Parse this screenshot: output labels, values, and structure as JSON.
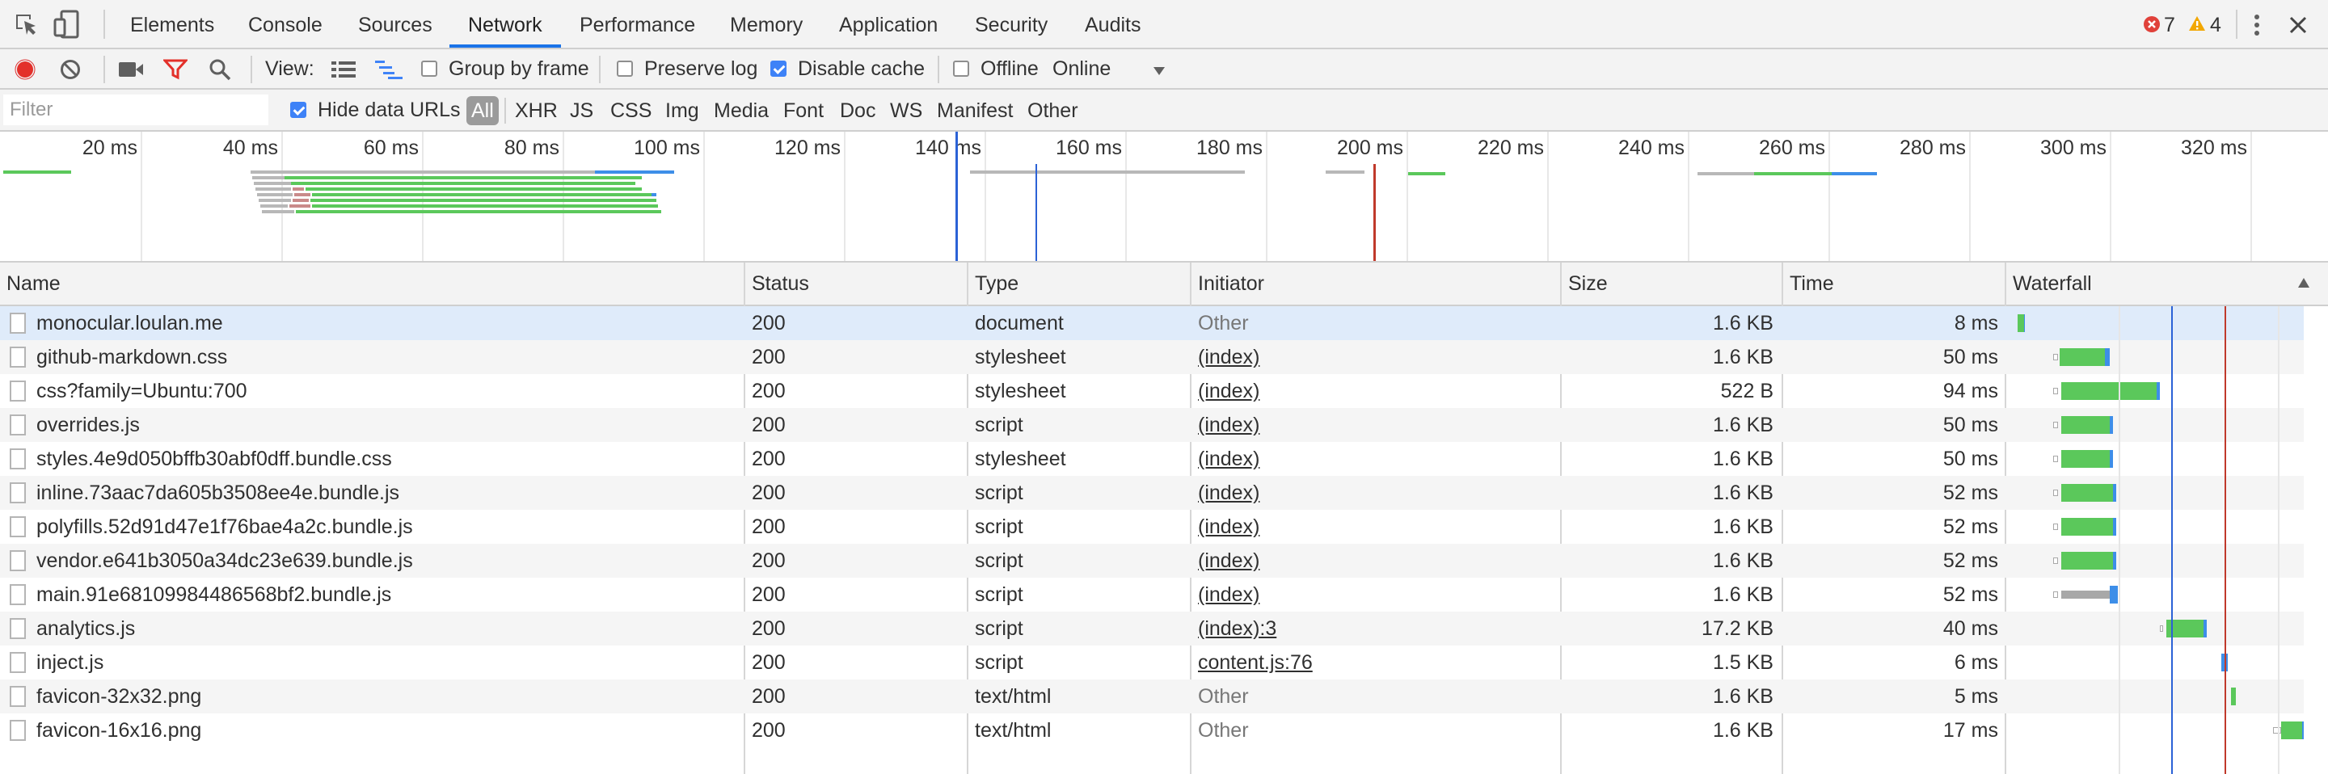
{
  "tabs": [
    "Elements",
    "Console",
    "Sources",
    "Network",
    "Performance",
    "Memory",
    "Application",
    "Security",
    "Audits"
  ],
  "active_tab": "Network",
  "error_count": "7",
  "warning_count": "4",
  "toolbar": {
    "view_label": "View:",
    "group_by_frame": "Group by frame",
    "preserve_log": "Preserve log",
    "disable_cache": "Disable cache",
    "offline": "Offline",
    "throttling": "Online"
  },
  "filter": {
    "placeholder": "Filter",
    "hide_data_urls": "Hide data URLs",
    "types": [
      "All",
      "XHR",
      "JS",
      "CSS",
      "Img",
      "Media",
      "Font",
      "Doc",
      "WS",
      "Manifest",
      "Other"
    ]
  },
  "overview_ticks": [
    "20 ms",
    "40 ms",
    "60 ms",
    "80 ms",
    "100 ms",
    "120 ms",
    "140 ms",
    "160 ms",
    "180 ms",
    "200 ms",
    "220 ms",
    "240 ms",
    "260 ms",
    "280 ms",
    "300 ms",
    "320 ms"
  ],
  "columns": [
    "Name",
    "Status",
    "Type",
    "Initiator",
    "Size",
    "Time",
    "Waterfall"
  ],
  "requests": [
    {
      "name": "monocular.loulan.me",
      "status": "200",
      "type": "document",
      "initiator": "Other",
      "size": "1.6 KB",
      "time": "8 ms"
    },
    {
      "name": "github-markdown.css",
      "status": "200",
      "type": "stylesheet",
      "initiator": "(index)",
      "size": "1.6 KB",
      "time": "50 ms"
    },
    {
      "name": "css?family=Ubuntu:700",
      "status": "200",
      "type": "stylesheet",
      "initiator": "(index)",
      "size": "522 B",
      "time": "94 ms"
    },
    {
      "name": "overrides.js",
      "status": "200",
      "type": "script",
      "initiator": "(index)",
      "size": "1.6 KB",
      "time": "50 ms"
    },
    {
      "name": "styles.4e9d050bffb30abf0dff.bundle.css",
      "status": "200",
      "type": "stylesheet",
      "initiator": "(index)",
      "size": "1.6 KB",
      "time": "50 ms"
    },
    {
      "name": "inline.73aac7da605b3508ee4e.bundle.js",
      "status": "200",
      "type": "script",
      "initiator": "(index)",
      "size": "1.6 KB",
      "time": "52 ms"
    },
    {
      "name": "polyfills.52d91d47e1f76bae4a2c.bundle.js",
      "status": "200",
      "type": "script",
      "initiator": "(index)",
      "size": "1.6 KB",
      "time": "52 ms"
    },
    {
      "name": "vendor.e641b3050a34dc23e639.bundle.js",
      "status": "200",
      "type": "script",
      "initiator": "(index)",
      "size": "1.6 KB",
      "time": "52 ms"
    },
    {
      "name": "main.91e68109984486568bf2.bundle.js",
      "status": "200",
      "type": "script",
      "initiator": "(index)",
      "size": "1.6 KB",
      "time": "52 ms"
    },
    {
      "name": "analytics.js",
      "status": "200",
      "type": "script",
      "initiator": "(index):3",
      "size": "17.2 KB",
      "time": "40 ms"
    },
    {
      "name": "inject.js",
      "status": "200",
      "type": "script",
      "initiator": "content.js:76",
      "size": "1.5 KB",
      "time": "6 ms"
    },
    {
      "name": "favicon-32x32.png",
      "status": "200",
      "type": "text/html",
      "initiator": "Other",
      "size": "1.6 KB",
      "time": "5 ms"
    },
    {
      "name": "favicon-16x16.png",
      "status": "200",
      "type": "text/html",
      "initiator": "Other",
      "size": "1.6 KB",
      "time": "17 ms"
    }
  ],
  "colors": {
    "waiting_green": "#5bc85b",
    "download_blue": "#3d8ee8",
    "queue_gray": "#b8b8b8",
    "dom_content_loaded": "#2b62d6",
    "load_event": "#c0392b"
  }
}
